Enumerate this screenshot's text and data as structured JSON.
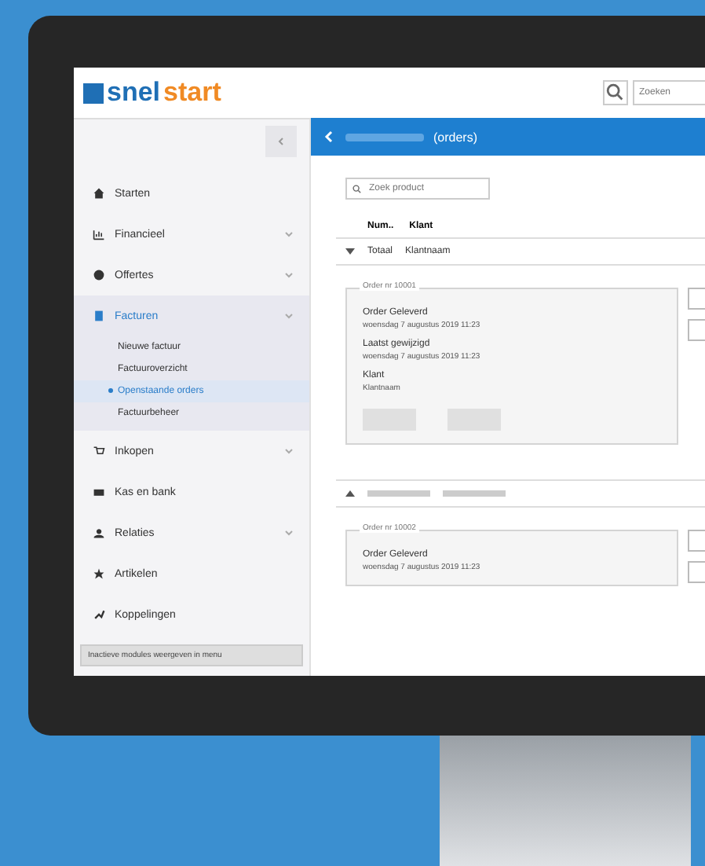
{
  "logo": {
    "part_1": "snel",
    "part_2": "start"
  },
  "search": {
    "placeholder": "Zoeken"
  },
  "sidebar": {
    "items": [
      {
        "label": "Starten",
        "expandable": false,
        "selected": false
      },
      {
        "label": "Financieel",
        "expandable": true,
        "selected": false
      },
      {
        "label": "Offertes",
        "expandable": true,
        "selected": false
      },
      {
        "label": "Facturen",
        "expandable": true,
        "selected": true,
        "children": [
          {
            "label": "Nieuwe factuur",
            "selected": false
          },
          {
            "label": "Factuuroverzicht",
            "selected": false
          },
          {
            "label": "Openstaande orders",
            "selected": true
          },
          {
            "label": "Factuurbeheer",
            "selected": false
          }
        ]
      },
      {
        "label": "Inkopen",
        "expandable": true,
        "selected": false
      },
      {
        "label": "Kas en bank",
        "expandable": false,
        "selected": false
      },
      {
        "label": "Relaties",
        "expandable": true,
        "selected": false
      },
      {
        "label": "Artikelen",
        "expandable": false,
        "selected": false
      },
      {
        "label": "Koppelingen",
        "expandable": false,
        "selected": false
      }
    ],
    "footer_button": "Inactieve modules weergeven in menu"
  },
  "header": {
    "title": "(orders)"
  },
  "filter": {
    "placeholder": "Zoek product"
  },
  "columns": [
    "Num..",
    "Klant"
  ],
  "groups": [
    {
      "expanded": true,
      "label": "Totaal",
      "customer": "Klantnaam",
      "order": {
        "legend": "Order nr 10001",
        "fields": [
          {
            "label": "Order Geleverd",
            "value": "woensdag 7 augustus 2019 11:23"
          },
          {
            "label": "Laatst gewijzigd",
            "value": "woensdag 7 augustus 2019 11:23"
          }
        ],
        "customer_label": "Klant",
        "customer": "Klantnaam"
      }
    },
    {
      "expanded": false,
      "order": {
        "legend": "Order nr 10002",
        "fields": [
          {
            "label": "Order Geleverd",
            "value": "woensdag 7 augustus 2019 11:23"
          }
        ]
      }
    }
  ]
}
